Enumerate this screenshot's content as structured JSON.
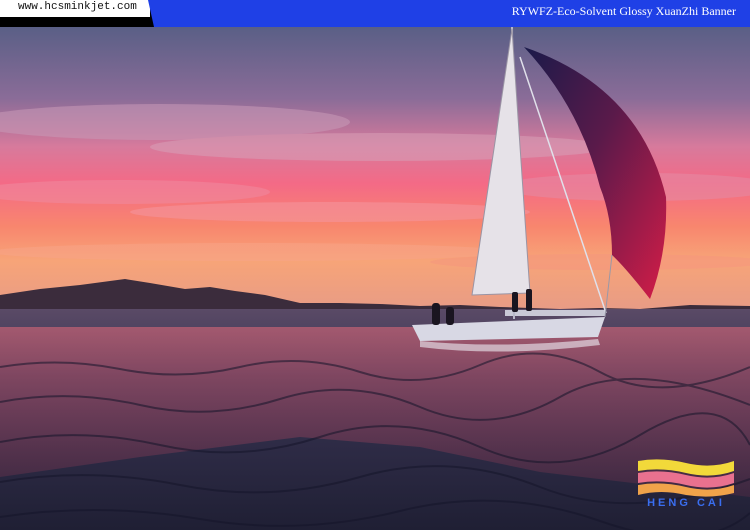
{
  "header": {
    "site_url": "www.hcsminkjet.com",
    "product_title": "RYWFZ-Eco-Solvent Glossy XuanZhi Banner"
  },
  "logo": {
    "text": "HENG CAI",
    "colors": [
      "#f2d93a",
      "#e9718f",
      "#f0a34a"
    ]
  },
  "colors": {
    "title_band": "#1f40e6",
    "sky_top": "#5a5f86",
    "sky_glow": "#f46a86",
    "water": "#2d2d45",
    "sail_spinnaker": "#c41a47"
  }
}
